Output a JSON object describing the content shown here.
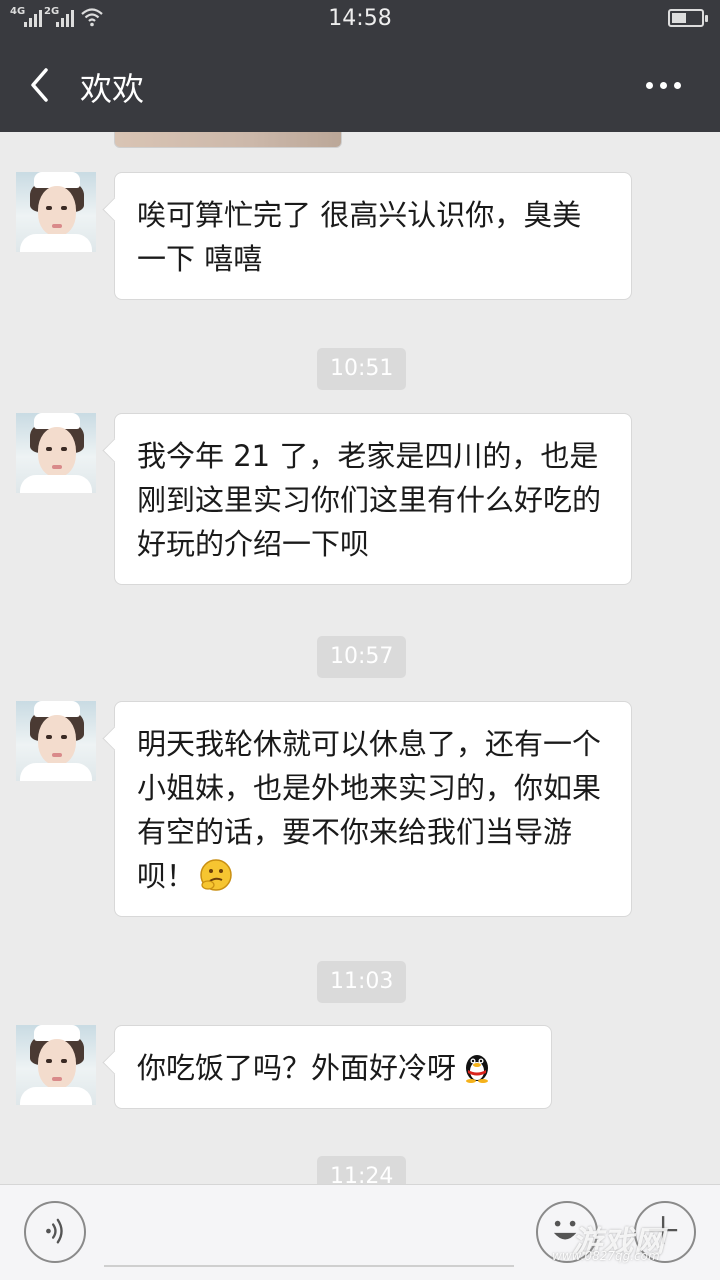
{
  "status_bar": {
    "time": "14:58",
    "network_1": "4G",
    "network_2": "2G",
    "icons": [
      "signal-icon",
      "wifi-icon",
      "battery-icon"
    ]
  },
  "header": {
    "title": "欢欢",
    "back_icon": "chevron-left-icon",
    "more_icon": "more-dots-icon"
  },
  "chat": {
    "messages": [
      {
        "type": "text",
        "sender": "欢欢",
        "text": "唉可算忙完了 很高兴认识你，臭美一下 嘻嘻"
      },
      {
        "type": "timestamp",
        "text": "10:51"
      },
      {
        "type": "text",
        "sender": "欢欢",
        "text": "我今年 21 了，老家是四川的，也是刚到这里实习你们这里有什么好吃的好玩的介绍一下呗"
      },
      {
        "type": "timestamp",
        "text": "10:57"
      },
      {
        "type": "text",
        "sender": "欢欢",
        "text": "明天我轮休就可以休息了，还有一个小姐妹，也是外地来实习的，你如果有空的话，要不你来给我们当导游呗！",
        "emoji": "thinking-emoji-icon"
      },
      {
        "type": "timestamp",
        "text": "11:03"
      },
      {
        "type": "text",
        "sender": "欢欢",
        "text": "你吃饭了吗？外面好冷呀",
        "emoji": "qq-penguin-emoji-icon"
      },
      {
        "type": "timestamp",
        "text": "11:24"
      }
    ]
  },
  "input_bar": {
    "voice_icon": "voice-icon",
    "emoji_icon": "smiley-icon",
    "plus_icon": "plus-icon"
  },
  "watermark": {
    "text": "游戏网",
    "url": "www.0827qg.com"
  },
  "colors": {
    "header_bg": "#393a3f",
    "chat_bg": "#ebebeb",
    "bubble_bg": "#ffffff",
    "timestamp_bg": "#dadada"
  }
}
